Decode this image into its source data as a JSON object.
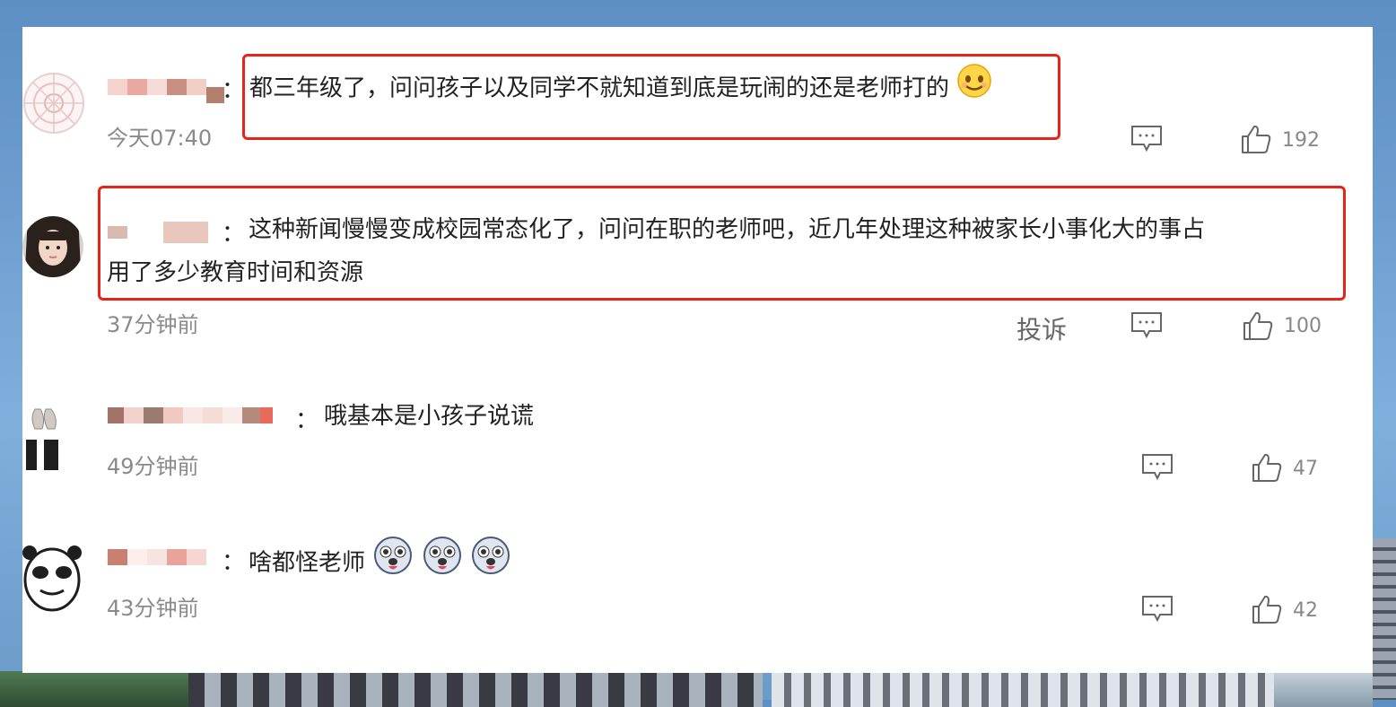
{
  "comments": [
    {
      "text": "都三年级了，问问孩子以及同学不就知道到底是玩闹的还是老师打的",
      "time": "今天07:40",
      "likes": "192",
      "emoji_count": 1
    },
    {
      "text_line1": "这种新闻慢慢变成校园常态化了，问问在职的老师吧，近几年处理这种被家长小事化大的事占",
      "text_line2": "用了多少教育时间和资源",
      "time": "37分钟前",
      "report_label": "投诉",
      "likes": "100"
    },
    {
      "text": "哦基本是小孩子说谎",
      "time": "49分钟前",
      "likes": "47"
    },
    {
      "text": "啥都怪老师",
      "time": "43分钟前",
      "likes": "42",
      "emoji_count": 3
    }
  ],
  "colon": "：",
  "icons": {
    "reply": "comment-bubble-icon",
    "like": "thumbs-up-icon"
  },
  "colors": {
    "highlight": "#e8231a",
    "text": "#222222",
    "meta": "#8a8a8a"
  }
}
